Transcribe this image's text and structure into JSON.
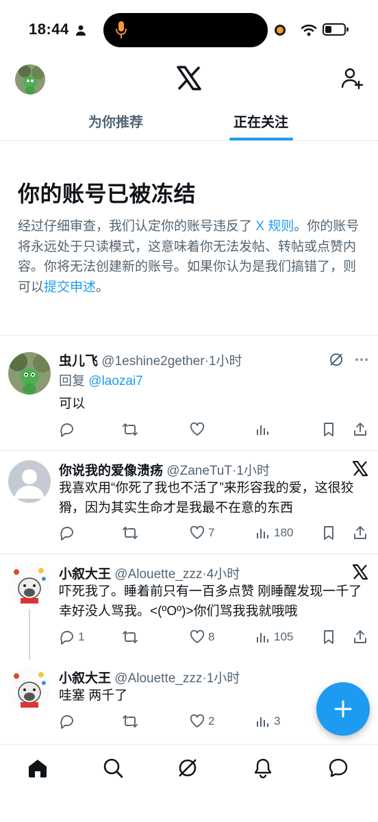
{
  "status_bar": {
    "time": "18:44"
  },
  "tabs": [
    {
      "label": "为你推荐"
    },
    {
      "label": "正在关注"
    }
  ],
  "notice": {
    "title": "你的账号已被冻结",
    "body_1": "经过仔细审查，我们认定你的账号违反了 ",
    "rules_link": "X 规则",
    "body_2": "。你的账号将永远处于只读模式，这意味着你无法发帖、转帖或点赞内容。你将无法创建新的账号。如果你认为是我们搞错了，则可以",
    "appeal_link": "提交申述",
    "body_3": "。"
  },
  "tweets": [
    {
      "name": "虫儿飞",
      "handle": "@1eshine2gether",
      "time": "·1小时",
      "reply_prefix": "回复 ",
      "reply_to": "@laozai7",
      "text": "可以",
      "likes": "",
      "views": ""
    },
    {
      "name": "你说我的爱像溃疡",
      "handle": "@ZaneTuT",
      "time": "·1小时",
      "text": "我喜欢用“你死了我也不活了”来形容我的爱，这很狡猾，因为其实生命才是我最不在意的东西",
      "likes": "7",
      "views": "180"
    },
    {
      "name": "小叙大王",
      "handle": "@Alouette_zzz",
      "time": "·4小时",
      "text": "吓死我了。睡着前只有一百多点赞 刚睡醒发现一千了 幸好没人骂我。<(ºOº)>你们骂我我就哦哦",
      "replies": "1",
      "likes": "8",
      "views": "105"
    },
    {
      "name": "小叙大王",
      "handle": "@Alouette_zzz",
      "time": "·1小时",
      "text": "哇塞 两千了",
      "likes": "2",
      "views": "3"
    }
  ],
  "colors": {
    "accent": "#1d9bf0",
    "text": "#0f1419",
    "secondary": "#536471",
    "divider": "#e6e9eb"
  }
}
